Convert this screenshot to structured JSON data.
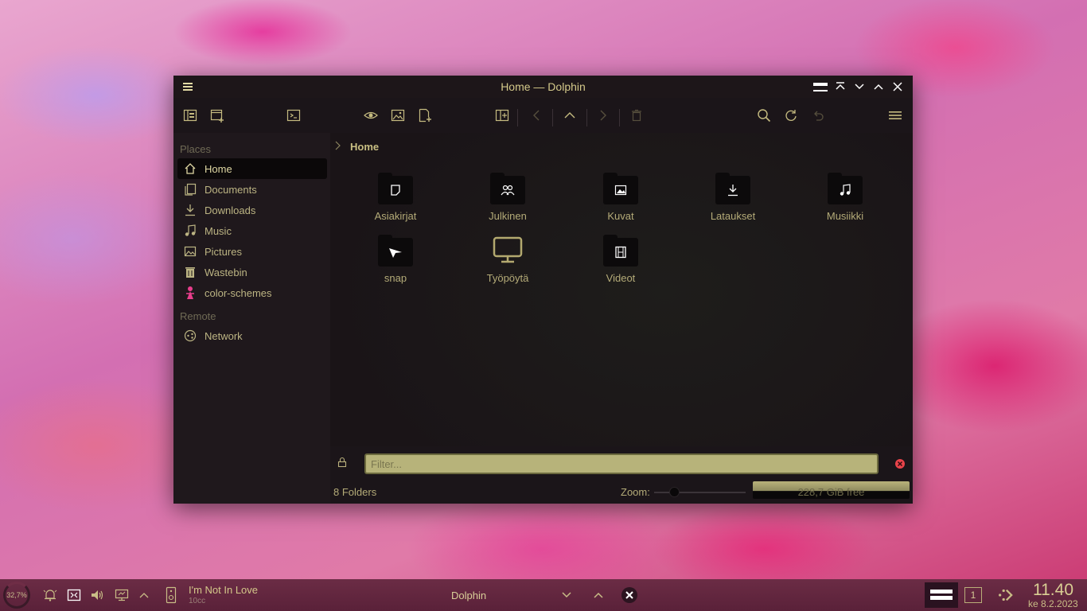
{
  "window": {
    "title": "Home — Dolphin"
  },
  "sidebar": {
    "places_label": "Places",
    "remote_label": "Remote",
    "places": [
      {
        "label": "Home",
        "icon": "home-icon"
      },
      {
        "label": "Documents",
        "icon": "documents-icon"
      },
      {
        "label": "Downloads",
        "icon": "downloads-icon"
      },
      {
        "label": "Music",
        "icon": "music-icon"
      },
      {
        "label": "Pictures",
        "icon": "pictures-icon"
      },
      {
        "label": "Wastebin",
        "icon": "trash-icon"
      },
      {
        "label": "color-schemes",
        "icon": "color-schemes-icon"
      }
    ],
    "remote": [
      {
        "label": "Network",
        "icon": "network-icon"
      }
    ]
  },
  "breadcrumb": {
    "current": "Home"
  },
  "items": [
    {
      "label": "Asiakirjat",
      "icon": "document-folder-icon"
    },
    {
      "label": "Julkinen",
      "icon": "public-folder-icon"
    },
    {
      "label": "Kuvat",
      "icon": "pictures-folder-icon"
    },
    {
      "label": "Lataukset",
      "icon": "downloads-folder-icon"
    },
    {
      "label": "Musiikki",
      "icon": "music-folder-icon"
    },
    {
      "label": "snap",
      "icon": "snap-folder-icon"
    },
    {
      "label": "Työpöytä",
      "icon": "desktop-icon"
    },
    {
      "label": "Videot",
      "icon": "videos-folder-icon"
    }
  ],
  "filter": {
    "placeholder": "Filter..."
  },
  "status": {
    "summary": "8 Folders",
    "zoom_label": "Zoom:",
    "free_space": "228,7 GiB free",
    "used_fraction": 0.55
  },
  "taskbar": {
    "cpu": "32,7%",
    "media_title": "I'm Not In Love",
    "media_artist": "10cc",
    "task_title": "Dolphin",
    "pager": "1",
    "time": "11.40",
    "date": "ke 8.2.2023"
  },
  "colors": {
    "accent": "#c9bf83",
    "window_bg": "#1b1519",
    "taskbar_bg": "#5a2139",
    "filter_bg": "#b7b37a"
  }
}
